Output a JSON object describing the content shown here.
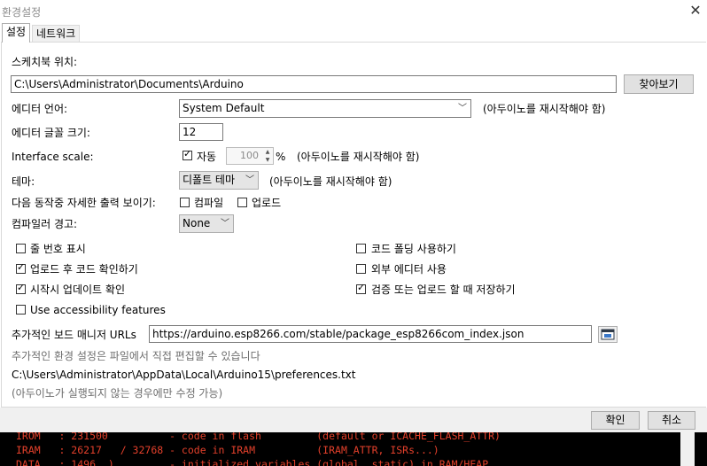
{
  "window": {
    "title": "환경설정"
  },
  "tabs": [
    {
      "label": "설정"
    },
    {
      "label": "네트워크"
    }
  ],
  "settings": {
    "sketchbook_label": "스케치북 위치:",
    "sketchbook_path": "C:\\Users\\Administrator\\Documents\\Arduino",
    "browse_button": "찾아보기",
    "editor_language_label": "에디터 언어:",
    "editor_language_value": "System Default",
    "restart_note": "(아두이노를 재시작해야 함)",
    "font_size_label": "에디터 글꼴 크기:",
    "font_size_value": "12",
    "interface_scale_label": "Interface scale:",
    "auto_label": "자동",
    "scale_value": "100",
    "percent": "%",
    "theme_label": "테마:",
    "theme_value": "디폴트 테마",
    "verbose_label": "다음 동작중 자세한  출력 보이기:",
    "compile_label": "컴파일",
    "upload_label": "업로드",
    "compiler_warnings_label": "컴파일러 경고:",
    "compiler_warnings_value": "None",
    "options": {
      "line_numbers": "줄 번호 표시",
      "code_folding": "코드 폴딩 사용하기",
      "verify_after_upload": "업로드 후 코드 확인하기",
      "external_editor": "외부 에디터 사용",
      "check_updates": "시작시 업데이트 확인",
      "save_on_verify": "검증 또는 업로드 할 때 저장하기",
      "accessibility": "Use accessibility features"
    },
    "board_manager_label": "추가적인 보드 매니저 URLs",
    "board_manager_url": "https://arduino.esp8266.com/stable/package_esp8266com_index.json",
    "more_prefs_note": "추가적인 환경 설정은 파일에서 직접 편집할 수 있습니다",
    "prefs_path": "C:\\Users\\Administrator\\AppData\\Local\\Arduino15\\preferences.txt",
    "edit_note": "(아두이노가 실행되지 않는 경우에만 수정 가능)"
  },
  "checkbox_state": {
    "auto": true,
    "compile": false,
    "upload": false,
    "line_numbers": false,
    "code_folding": false,
    "verify_after_upload": true,
    "external_editor": false,
    "check_updates": true,
    "save_on_verify": true,
    "accessibility": false
  },
  "footer": {
    "ok": "확인",
    "cancel": "취소"
  },
  "console": {
    "lines": [
      "IROM   : 231500          - code in flash         (default or ICACHE_FLASH_ATTR)",
      "IRAM   : 26217   / 32768 - code in IRAM          (IRAM_ATTR, ISRs...)",
      "DATA   : 1496  )         - initialized variables (global, static) in RAM/HEAP"
    ],
    "text_color": "#e3402b"
  },
  "icons": {
    "close": "close-icon",
    "expand": "expand-window-icon",
    "dropdown": "chevron-down-icon"
  }
}
